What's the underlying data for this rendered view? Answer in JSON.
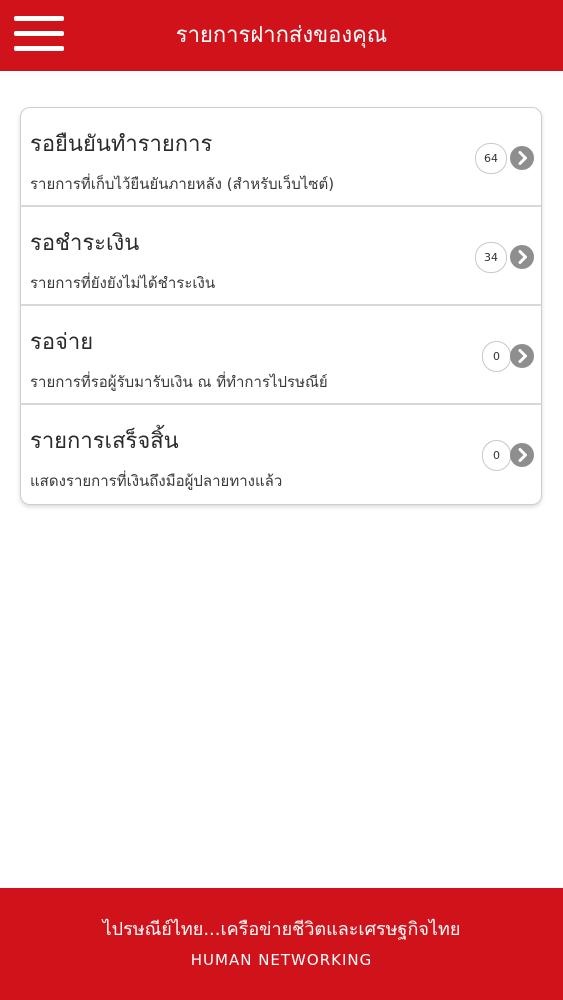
{
  "header": {
    "title": "รายการฝากส่งของคุณ",
    "menu_icon": "hamburger-menu-icon",
    "background": "#d0121b"
  },
  "list": {
    "items": [
      {
        "title": "รอยืนยันทำรายการ",
        "subtitle": "รายการที่เก็บไว้ยืนยันภายหลัง (สำหรับเว็บไซต์)",
        "count": "64",
        "icon": "chevron-right-circle-icon"
      },
      {
        "title": "รอชำระเงิน",
        "subtitle": "รายการที่ยังยังไม่ได้ชำระเงิน",
        "count": "34",
        "icon": "chevron-right-circle-icon"
      },
      {
        "title": "รอจ่าย",
        "subtitle": "รายการที่รอผู้รับมารับเงิน ณ ที่ทำการไปรษณีย์",
        "count": "0",
        "icon": "chevron-right-circle-icon"
      },
      {
        "title": "รายการเสร็จสิ้น",
        "subtitle": "แสดงรายการที่เงินถึงมือผู้ปลายทางแล้ว",
        "count": "0",
        "icon": "chevron-right-circle-icon"
      }
    ]
  },
  "footer": {
    "slogan_th": "ไปรษณีย์ไทย...เครือข่ายชีวิตและเศรษฐกิจไทย",
    "slogan_en": "HUMAN NETWORKING",
    "background": "#d0121b"
  }
}
